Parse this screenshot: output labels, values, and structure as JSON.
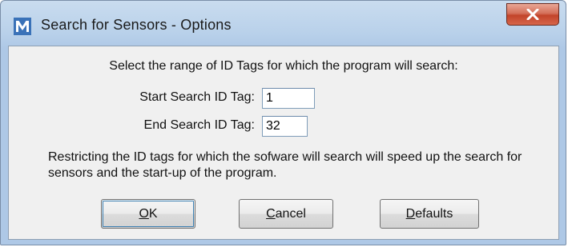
{
  "window": {
    "title": "Search for Sensors - Options",
    "app_icon": "app-m-icon",
    "close_icon": "close-icon",
    "accent_color": "#c2442a"
  },
  "dialog": {
    "instruction": "Select the range of ID Tags for which the program will search:",
    "start_label": "Start Search ID Tag:",
    "start_value": "1",
    "end_label": "End Search ID Tag:",
    "end_value": "32",
    "note": "Restricting the ID tags for which the sofware will search will speed up the search for sensors and the start-up of the program."
  },
  "buttons": {
    "ok": {
      "mnemonic": "O",
      "rest": "K"
    },
    "cancel": {
      "mnemonic": "C",
      "rest": "ancel"
    },
    "defaults": {
      "mnemonic": "D",
      "rest": "efaults"
    }
  }
}
